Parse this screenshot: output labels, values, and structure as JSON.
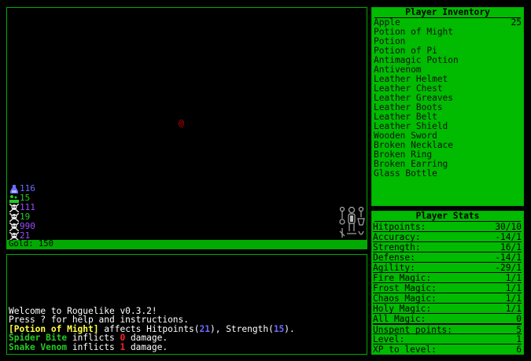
{
  "map": {
    "player_glyph": "@",
    "gold_label": "Gold: 150",
    "statuses": [
      {
        "icon": "potion-icon",
        "color": "#6b6bff",
        "value": "116"
      },
      {
        "icon": "bubbles-icon",
        "color": "#22cc22",
        "value": "15"
      },
      {
        "icon": "skull-icon",
        "color": "#9a4dff",
        "value": "111"
      },
      {
        "icon": "skull-icon",
        "color": "#22cc22",
        "value": "19"
      },
      {
        "icon": "skull-icon",
        "color": "#9a4dff",
        "value": "990"
      },
      {
        "icon": "skull-icon",
        "color": "#9a4dff",
        "value": "21"
      }
    ]
  },
  "log": {
    "lines": [
      {
        "parts": [
          {
            "t": "Welcome to Roguelike v0.3.2!",
            "c": "#ffffff"
          }
        ]
      },
      {
        "parts": [
          {
            "t": "Press ? for help and instructions.",
            "c": "#ffffff"
          }
        ]
      },
      {
        "parts": [
          {
            "t": "[Potion of Might]",
            "c": "#ffff44",
            "b": true
          },
          {
            "t": " affects Hitpoints(",
            "c": "#ffffff"
          },
          {
            "t": "21",
            "c": "#6b6bff",
            "b": true
          },
          {
            "t": "), Strength(",
            "c": "#ffffff"
          },
          {
            "t": "15",
            "c": "#6b6bff",
            "b": true
          },
          {
            "t": ").",
            "c": "#ffffff"
          }
        ]
      },
      {
        "parts": [
          {
            "t": "Spider Bite",
            "c": "#22cc22",
            "b": true
          },
          {
            "t": " inflicts ",
            "c": "#ffffff"
          },
          {
            "t": "0",
            "c": "#ff2222",
            "b": true
          },
          {
            "t": " damage.",
            "c": "#ffffff"
          }
        ]
      },
      {
        "parts": [
          {
            "t": "Snake Venom",
            "c": "#22cc22",
            "b": true
          },
          {
            "t": " inflicts ",
            "c": "#ffffff"
          },
          {
            "t": "1",
            "c": "#ff2222",
            "b": true
          },
          {
            "t": " damage.",
            "c": "#ffffff"
          }
        ]
      }
    ]
  },
  "inventory": {
    "title": "Player Inventory",
    "items": [
      {
        "name": "Apple",
        "count": "25"
      },
      {
        "name": "Potion of Might",
        "count": ""
      },
      {
        "name": "Potion",
        "count": ""
      },
      {
        "name": "Potion of Pi",
        "count": ""
      },
      {
        "name": "Antimagic Potion",
        "count": ""
      },
      {
        "name": "Antivenom",
        "count": ""
      },
      {
        "name": "Leather Helmet",
        "count": ""
      },
      {
        "name": "Leather Chest",
        "count": ""
      },
      {
        "name": "Leather Greaves",
        "count": ""
      },
      {
        "name": "Leather Boots",
        "count": ""
      },
      {
        "name": "Leather Belt",
        "count": ""
      },
      {
        "name": "Leather Shield",
        "count": ""
      },
      {
        "name": "Wooden Sword",
        "count": ""
      },
      {
        "name": "Broken Necklace",
        "count": ""
      },
      {
        "name": "Broken Ring",
        "count": ""
      },
      {
        "name": "Broken Earring",
        "count": ""
      },
      {
        "name": "Glass Bottle",
        "count": ""
      }
    ]
  },
  "stats": {
    "title": "Player Stats",
    "rows": [
      {
        "label": "Hitpoints:",
        "value": "30/10"
      },
      {
        "label": "Accuracy:",
        "value": "-14/1"
      },
      {
        "label": "Strength:",
        "value": "16/1"
      },
      {
        "label": "Defense:",
        "value": "-14/1"
      },
      {
        "label": "Agility:",
        "value": "-29/1"
      },
      {
        "label": "Fire Magic:",
        "value": "1/1"
      },
      {
        "label": "Frost Magic:",
        "value": "1/1"
      },
      {
        "label": "Chaos Magic:",
        "value": "1/1"
      },
      {
        "label": "Holy Magic:",
        "value": "1/1"
      },
      {
        "label": "All Magic:",
        "value": "0"
      },
      {
        "label": "Unspent points:",
        "value": "5"
      },
      {
        "label": "Level:",
        "value": "1"
      },
      {
        "label": "XP to level:",
        "value": "6"
      }
    ]
  }
}
